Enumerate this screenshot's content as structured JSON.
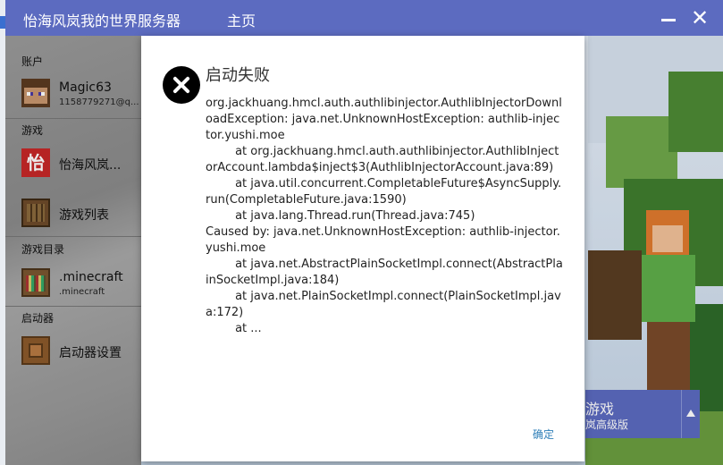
{
  "window": {
    "title": "怡海风岚我的世界服务器",
    "nav_home": "主页",
    "close_glyph": "✕"
  },
  "sidebar": {
    "account_label": "账户",
    "account": {
      "name": "Magic63",
      "email": "1158779271@q..."
    },
    "game_label": "游戏",
    "server": {
      "name": "怡海风岚...",
      "icon_char": "怡"
    },
    "game_list": "游戏列表",
    "game_dir_label": "游戏目录",
    "game_dir": {
      "name": ".minecraft",
      "sub": ".minecraft"
    },
    "launcher_label": "启动器",
    "launcher_settings": "启动器设置"
  },
  "play": {
    "line1": "游戏",
    "line2": "岚高级版"
  },
  "dialog": {
    "title": "启动失败",
    "message": "org.jackhuang.hmcl.auth.authlibinjector.AuthlibInjectorDownloadException: java.net.UnknownHostException: authlib-injector.yushi.moe\n\tat org.jackhuang.hmcl.auth.authlibinjector.AuthlibInjectorAccount.lambda$inject$3(AuthlibInjectorAccount.java:89)\n\tat java.util.concurrent.CompletableFuture$AsyncSupply.run(CompletableFuture.java:1590)\n\tat java.lang.Thread.run(Thread.java:745)\nCaused by: java.net.UnknownHostException: authlib-injector.yushi.moe\n\tat java.net.AbstractPlainSocketImpl.connect(AbstractPlainSocketImpl.java:184)\n\tat java.net.PlainSocketImpl.connect(PlainSocketImpl.java:172)\n\tat ...",
    "confirm": "确定"
  },
  "colors": {
    "accent": "#5c6bc0",
    "link": "#2f7fb8"
  }
}
